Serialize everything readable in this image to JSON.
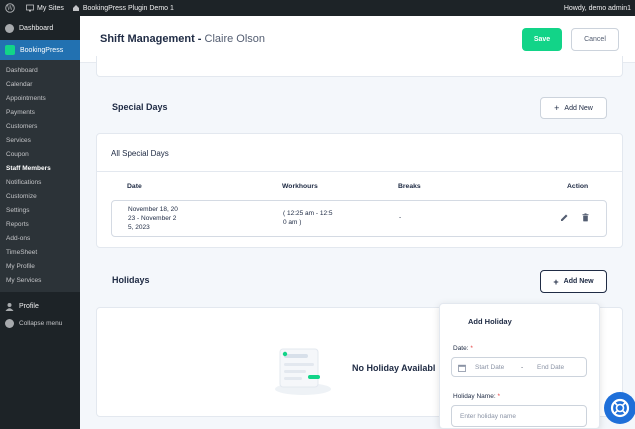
{
  "adminbar": {
    "my_sites": "My Sites",
    "site_name": "BookingPress Plugin Demo 1",
    "howdy": "Howdy, demo admin1"
  },
  "sidebar": {
    "dashboard": "Dashboard",
    "bookingpress": "BookingPress",
    "items": [
      "Dashboard",
      "Calendar",
      "Appointments",
      "Payments",
      "Customers",
      "Services",
      "Coupon",
      "Staff Members",
      "Notifications",
      "Customize",
      "Settings",
      "Reports",
      "Add-ons",
      "TimeSheet",
      "My Profile",
      "My Services"
    ],
    "current_index": 7,
    "profile": "Profile",
    "collapse": "Collapse menu"
  },
  "header": {
    "title": "Shift Management - ",
    "staff_name": "Claire Olson",
    "save": "Save",
    "cancel": "Cancel"
  },
  "special_days": {
    "title": "Special Days",
    "add_label": "Add New",
    "panel_title": "All Special Days",
    "columns": {
      "date": "Date",
      "workhours": "Workhours",
      "breaks": "Breaks",
      "action": "Action"
    },
    "row": {
      "date_l1": "November 18, 20",
      "date_l2": "23 - November 2",
      "date_l3": "5, 2023",
      "work_l1": "( 12:25 am - 12:5",
      "work_l2": "0 am )",
      "breaks": "-"
    }
  },
  "holidays": {
    "title": "Holidays",
    "add_label": "Add New",
    "empty": "No Holiday Availabl"
  },
  "add_holiday": {
    "title": "Add Holiday",
    "date_label": "Date:",
    "start_placeholder": "Start Date",
    "separator": "-",
    "end_placeholder": "End Date",
    "name_label": "Holiday Name:",
    "name_placeholder": "Enter holiday name",
    "required_mark": "*"
  },
  "colors": {
    "accent": "#12d488",
    "primary_text": "#202c45",
    "admin_bar": "#1d2327",
    "active_menu": "#2271b1",
    "chat": "#1e6fd9"
  }
}
